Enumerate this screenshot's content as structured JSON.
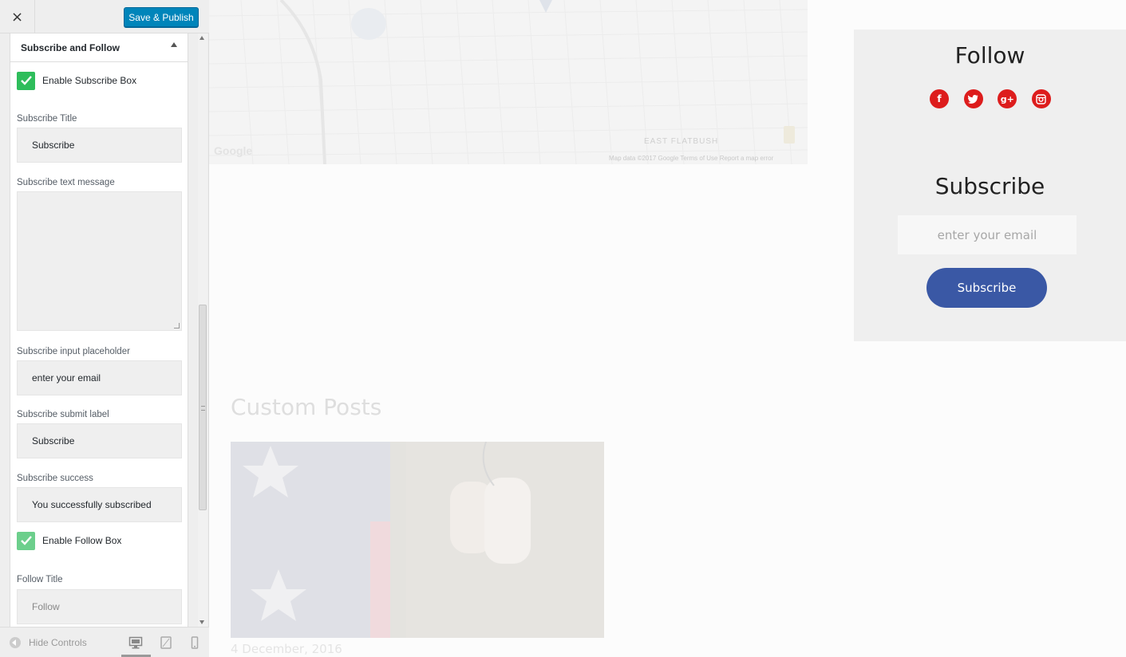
{
  "customizer": {
    "close_glyph": "×",
    "save_label": "Save & Publish",
    "section_title": "Subscribe and Follow",
    "enable_subscribe_label": "Enable Subscribe Box",
    "subscribe_title_label": "Subscribe Title",
    "subscribe_title_value": "Subscribe",
    "subscribe_text_label": "Subscribe text message",
    "subscribe_text_value": "",
    "subscribe_placeholder_label": "Subscribe input placeholder",
    "subscribe_placeholder_value": "enter your email",
    "subscribe_submit_label": "Subscribe submit label",
    "subscribe_submit_value": "Subscribe",
    "subscribe_success_label": "Subscribe success",
    "subscribe_success_value": "You successfully subscribed",
    "enable_follow_label": "Enable Follow Box",
    "follow_title_label": "Follow Title",
    "follow_title_value": "Follow",
    "hide_controls_label": "Hide Controls"
  },
  "preview": {
    "map": {
      "district_label": "EAST FLATBUSH",
      "google_label": "Google",
      "credit": "Map data ©2017 Google     Terms of Use     Report a map error"
    },
    "widget": {
      "follow_title": "Follow",
      "social_icons": [
        "facebook-icon",
        "twitter-icon",
        "google-plus-icon",
        "instagram-icon"
      ],
      "subscribe_title": "Subscribe",
      "email_placeholder": "enter your email",
      "subscribe_button": "Subscribe"
    },
    "custom_posts_title": "Custom Posts",
    "post_date": "4 December, 2016"
  },
  "colors": {
    "primary_button": "#0085ba",
    "checkbox_green": "#2ebd5b",
    "social_red": "#dd1d1d",
    "subscribe_blue": "#3a58a5"
  }
}
